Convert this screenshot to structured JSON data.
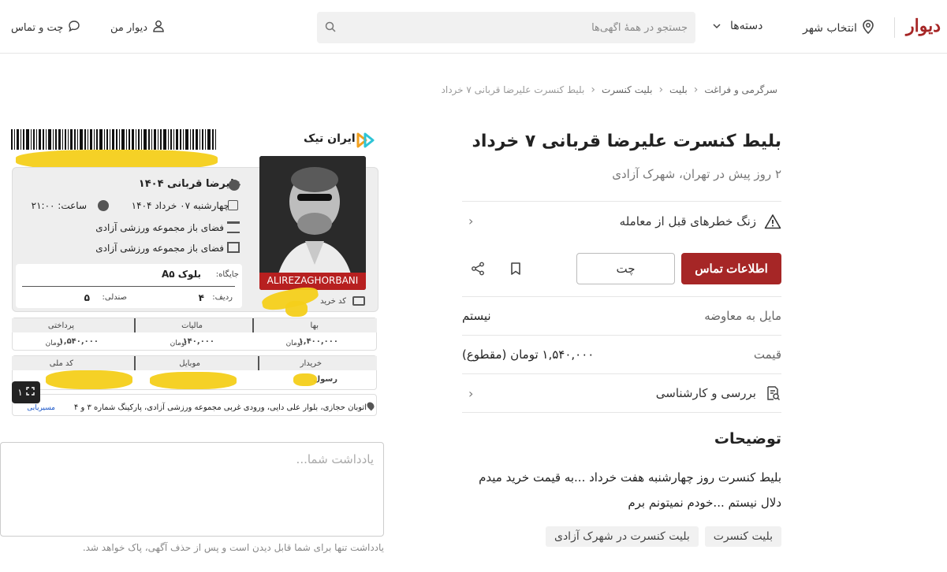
{
  "header": {
    "logo": "دیوار",
    "city_label": "انتخاب شهر",
    "categories_label": "دسته‌ها",
    "search_placeholder": "جستجو در همهٔ آگهی‌ها",
    "my_divar": "دیوار من",
    "chat_contact": "چت و تماس"
  },
  "breadcrumb": [
    "سرگرمی و فراغت",
    "بلیت",
    "بلیت کنسرت",
    "بلیط کنسرت علیرضا قربانی ۷ خرداد"
  ],
  "ad": {
    "title": "بلیط کنسرت علیرضا قربانی ۷ خرداد",
    "subtitle": "۲ روز پیش در تهران، شهرک آزادی",
    "warning": "زنگ خطرهای قبل از معامله",
    "contact_button": "اطلاعات تماس",
    "chat_button": "چت",
    "negotiable_label": "مایل به معاوضه",
    "negotiable_value": "نیستم",
    "price_label": "قیمت",
    "price_value": "۱,۵۴۰,۰۰۰ تومان (مقطوع)",
    "inspection": "بررسی و کارشناسی",
    "description_title": "توضیحات",
    "description_lines": [
      "بلیط کنسرت روز چهارشنبه هفت خرداد ...به قیمت خرید میدم",
      "دلال نیستم ...خودم نمیتونم برم"
    ],
    "tags": [
      "بلیت کنسرت",
      "بلیت کنسرت در شهرک آزادی"
    ]
  },
  "note": {
    "placeholder": "یادداشت شما...",
    "hint": "یادداشت تنها برای شما قابل دیدن است و پس از حذف آگهی، پاک خواهد شد."
  },
  "image": {
    "counter": "۱",
    "ticket": {
      "brand": "ایران تیک",
      "artist": "علیرضا قربانی ۱۴۰۴",
      "date": "چهارشنبه ۰۷ خرداد ۱۴۰۴",
      "time": "ساعت: ۲۱:۰۰",
      "venue1": "فضای باز مجموعه ورزشی آزادی",
      "venue2": "فضای باز مجموعه ورزشی آزادی",
      "seat_label": "جایگاه:",
      "seat_value": "بلوک A۵",
      "row_label": "ردیف:",
      "row_value": "۴",
      "chair_label": "صندلی:",
      "chair_value": "۵",
      "code_label": "کد خرید",
      "photo_caption": "ALIREZAGHORBANI",
      "price_h": "بها",
      "tax_h": "مالیات",
      "paid_h": "پرداختی",
      "price_v": "۱,۴۰۰,۰۰۰",
      "tax_v": "۱۴۰,۰۰۰",
      "paid_v": "۱,۵۴۰,۰۰۰",
      "toman": "تومان",
      "buyer_h": "خریدار",
      "mobile_h": "موبایل",
      "national_h": "کد ملی",
      "buyer_v": "رسول",
      "address": "اتوبان حجازی، بلوار علی دایی، ورودی غربی مجموعه ورزشی آزادی، پارکینگ شماره ۳ و ۴",
      "route": "مسیریابی"
    }
  }
}
